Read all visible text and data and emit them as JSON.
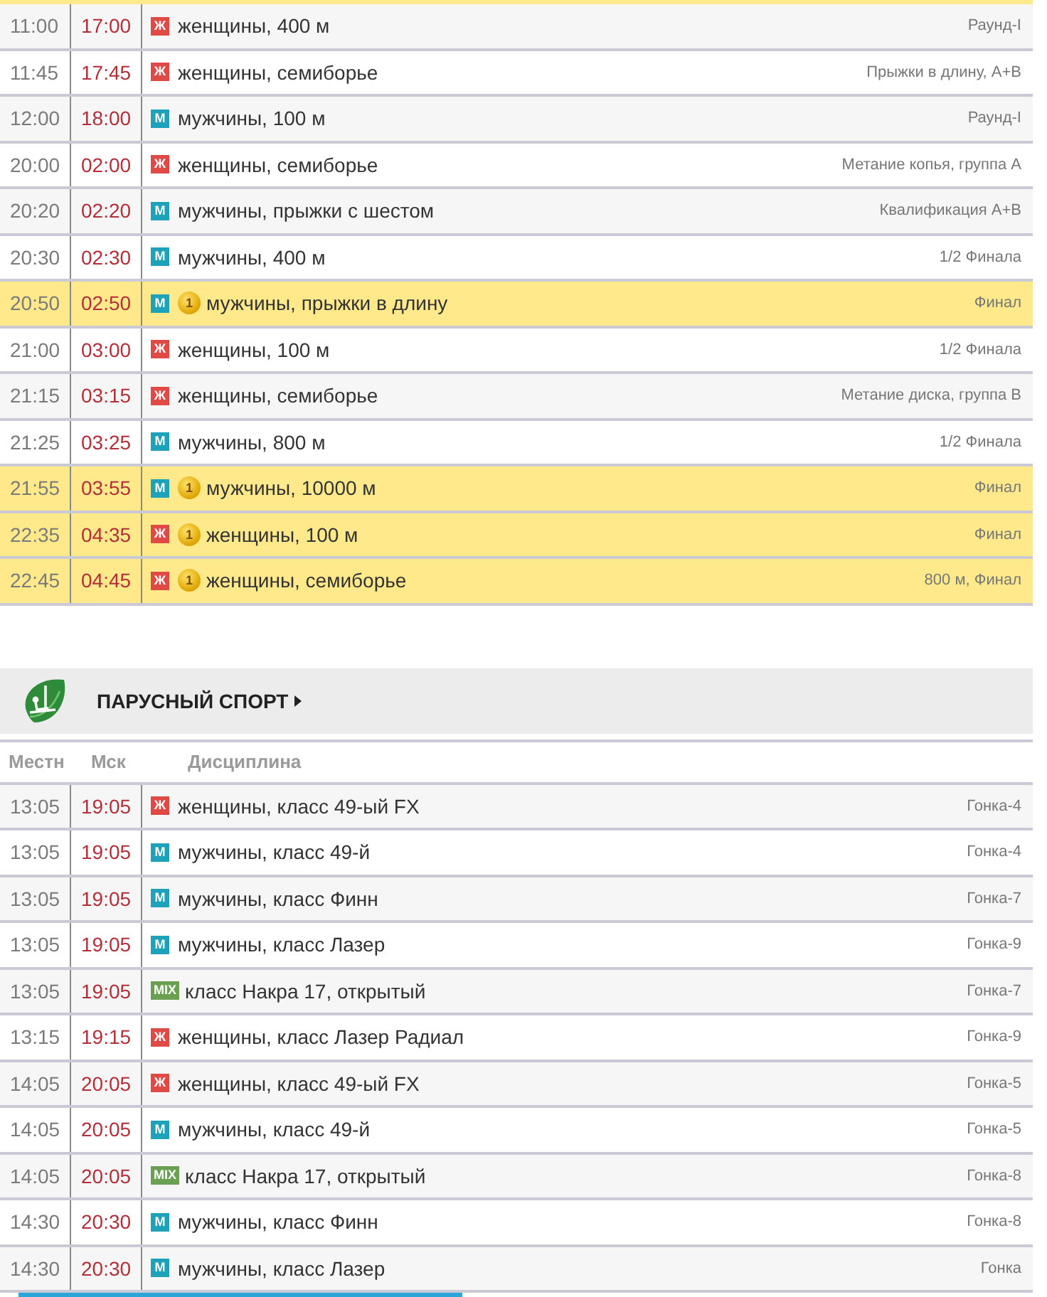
{
  "athletics": {
    "rows": [
      {
        "local": "11:00",
        "msk": "17:00",
        "badge": {
          "text": "Ж",
          "kind": "women"
        },
        "medal": null,
        "discipline": "женщины, 400 м",
        "stage": "Раунд-I"
      },
      {
        "local": "11:45",
        "msk": "17:45",
        "badge": {
          "text": "Ж",
          "kind": "women"
        },
        "medal": null,
        "discipline": "женщины, семиборье",
        "stage": "Прыжки в длину, А+В"
      },
      {
        "local": "12:00",
        "msk": "18:00",
        "badge": {
          "text": "М",
          "kind": "men"
        },
        "medal": null,
        "discipline": "мужчины, 100 м",
        "stage": "Раунд-I"
      },
      {
        "local": "20:00",
        "msk": "02:00",
        "badge": {
          "text": "Ж",
          "kind": "women"
        },
        "medal": null,
        "discipline": "женщины, семиборье",
        "stage": "Метание копья, группа А"
      },
      {
        "local": "20:20",
        "msk": "02:20",
        "badge": {
          "text": "М",
          "kind": "men"
        },
        "medal": null,
        "discipline": "мужчины, прыжки с шестом",
        "stage": "Квалификация А+В"
      },
      {
        "local": "20:30",
        "msk": "02:30",
        "badge": {
          "text": "М",
          "kind": "men"
        },
        "medal": null,
        "discipline": "мужчины, 400 м",
        "stage": "1/2 Финала"
      },
      {
        "local": "20:50",
        "msk": "02:50",
        "badge": {
          "text": "М",
          "kind": "men"
        },
        "medal": "1",
        "discipline": "мужчины, прыжки в длину",
        "stage": "Финал"
      },
      {
        "local": "21:00",
        "msk": "03:00",
        "badge": {
          "text": "Ж",
          "kind": "women"
        },
        "medal": null,
        "discipline": "женщины, 100 м",
        "stage": "1/2 Финала"
      },
      {
        "local": "21:15",
        "msk": "03:15",
        "badge": {
          "text": "Ж",
          "kind": "women"
        },
        "medal": null,
        "discipline": "женщины, семиборье",
        "stage": "Метание диска, группа В"
      },
      {
        "local": "21:25",
        "msk": "03:25",
        "badge": {
          "text": "М",
          "kind": "men"
        },
        "medal": null,
        "discipline": "мужчины, 800 м",
        "stage": "1/2 Финала"
      },
      {
        "local": "21:55",
        "msk": "03:55",
        "badge": {
          "text": "М",
          "kind": "men"
        },
        "medal": "1",
        "discipline": "мужчины, 10000 м",
        "stage": "Финал"
      },
      {
        "local": "22:35",
        "msk": "04:35",
        "badge": {
          "text": "Ж",
          "kind": "women"
        },
        "medal": "1",
        "discipline": "женщины, 100 м",
        "stage": "Финал"
      },
      {
        "local": "22:45",
        "msk": "04:45",
        "badge": {
          "text": "Ж",
          "kind": "women"
        },
        "medal": "1",
        "discipline": "женщины, семиборье",
        "stage": "800 м, Финал"
      }
    ]
  },
  "sailing": {
    "title": "ПАРУСНЫЙ СПОРТ",
    "columns": [
      "Местн",
      "Мск",
      "Дисциплина"
    ],
    "rows": [
      {
        "local": "13:05",
        "msk": "19:05",
        "badge": {
          "text": "Ж",
          "kind": "women"
        },
        "medal": null,
        "discipline": "женщины, класс 49-ый FX",
        "stage": "Гонка-4"
      },
      {
        "local": "13:05",
        "msk": "19:05",
        "badge": {
          "text": "М",
          "kind": "men"
        },
        "medal": null,
        "discipline": "мужчины, класс 49-й",
        "stage": "Гонка-4"
      },
      {
        "local": "13:05",
        "msk": "19:05",
        "badge": {
          "text": "М",
          "kind": "men"
        },
        "medal": null,
        "discipline": "мужчины, класс Финн",
        "stage": "Гонка-7"
      },
      {
        "local": "13:05",
        "msk": "19:05",
        "badge": {
          "text": "М",
          "kind": "men"
        },
        "medal": null,
        "discipline": "мужчины, класс Лазер",
        "stage": "Гонка-9"
      },
      {
        "local": "13:05",
        "msk": "19:05",
        "badge": {
          "text": "MIX",
          "kind": "mixed"
        },
        "medal": null,
        "discipline": "класс Накра 17, открытый",
        "stage": "Гонка-7"
      },
      {
        "local": "13:15",
        "msk": "19:15",
        "badge": {
          "text": "Ж",
          "kind": "women"
        },
        "medal": null,
        "discipline": "женщины, класс Лазер Радиал",
        "stage": "Гонка-9"
      },
      {
        "local": "14:05",
        "msk": "20:05",
        "badge": {
          "text": "Ж",
          "kind": "women"
        },
        "medal": null,
        "discipline": "женщины, класс 49-ый FX",
        "stage": "Гонка-5"
      },
      {
        "local": "14:05",
        "msk": "20:05",
        "badge": {
          "text": "М",
          "kind": "men"
        },
        "medal": null,
        "discipline": "мужчины, класс 49-й",
        "stage": "Гонка-5"
      },
      {
        "local": "14:05",
        "msk": "20:05",
        "badge": {
          "text": "MIX",
          "kind": "mixed"
        },
        "medal": null,
        "discipline": "класс Накра 17, открытый",
        "stage": "Гонка-8"
      },
      {
        "local": "14:30",
        "msk": "20:30",
        "badge": {
          "text": "М",
          "kind": "men"
        },
        "medal": null,
        "discipline": "мужчины, класс Финн",
        "stage": "Гонка-8"
      },
      {
        "local": "14:30",
        "msk": "20:30",
        "badge": {
          "text": "М",
          "kind": "men"
        },
        "medal": null,
        "discipline": "мужчины, класс Лазер",
        "stage": "Гонка"
      }
    ]
  }
}
